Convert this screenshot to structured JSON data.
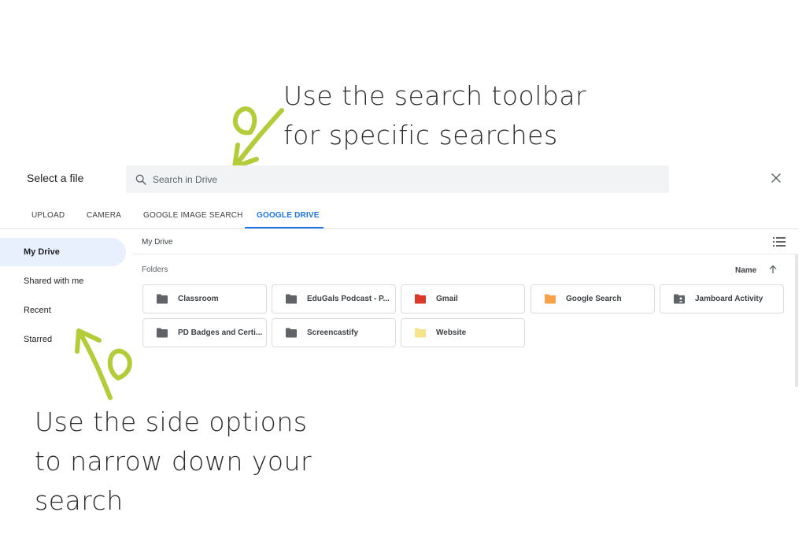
{
  "annotations": {
    "top_line1": "Use the search toolbar",
    "top_line2": "for specific searches",
    "bottom_line1": "Use the side options",
    "bottom_line2": "to narrow down your",
    "bottom_line3": "search",
    "arrow_color": "#b5cc3a"
  },
  "dialog": {
    "title": "Select a file",
    "search_placeholder": "Search in Drive"
  },
  "tabs": [
    {
      "label": "UPLOAD"
    },
    {
      "label": "CAMERA"
    },
    {
      "label": "GOOGLE IMAGE SEARCH"
    },
    {
      "label": "GOOGLE DRIVE",
      "active": true
    }
  ],
  "sidebar": {
    "items": [
      {
        "label": "My Drive",
        "active": true
      },
      {
        "label": "Shared with me"
      },
      {
        "label": "Recent"
      },
      {
        "label": "Starred"
      }
    ]
  },
  "main": {
    "breadcrumb": "My Drive",
    "section_label": "Folders",
    "sort_label": "Name",
    "folders": [
      {
        "name": "Classroom",
        "color": "#5f6368",
        "icon": "folder-icon"
      },
      {
        "name": "EduGals Podcast - P...",
        "color": "#5f6368",
        "icon": "folder-icon"
      },
      {
        "name": "Gmail",
        "color": "#db3a2b",
        "icon": "folder-icon"
      },
      {
        "name": "Google Search",
        "color": "#f6a24b",
        "icon": "folder-icon"
      },
      {
        "name": "Jamboard Activity",
        "color": "#5f6368",
        "icon": "shared-folder-icon"
      },
      {
        "name": "PD Badges and Certi...",
        "color": "#5f6368",
        "icon": "folder-icon"
      },
      {
        "name": "Screencastify",
        "color": "#5f6368",
        "icon": "folder-icon"
      },
      {
        "name": "Website",
        "color": "#f7e38a",
        "icon": "folder-icon"
      }
    ]
  }
}
